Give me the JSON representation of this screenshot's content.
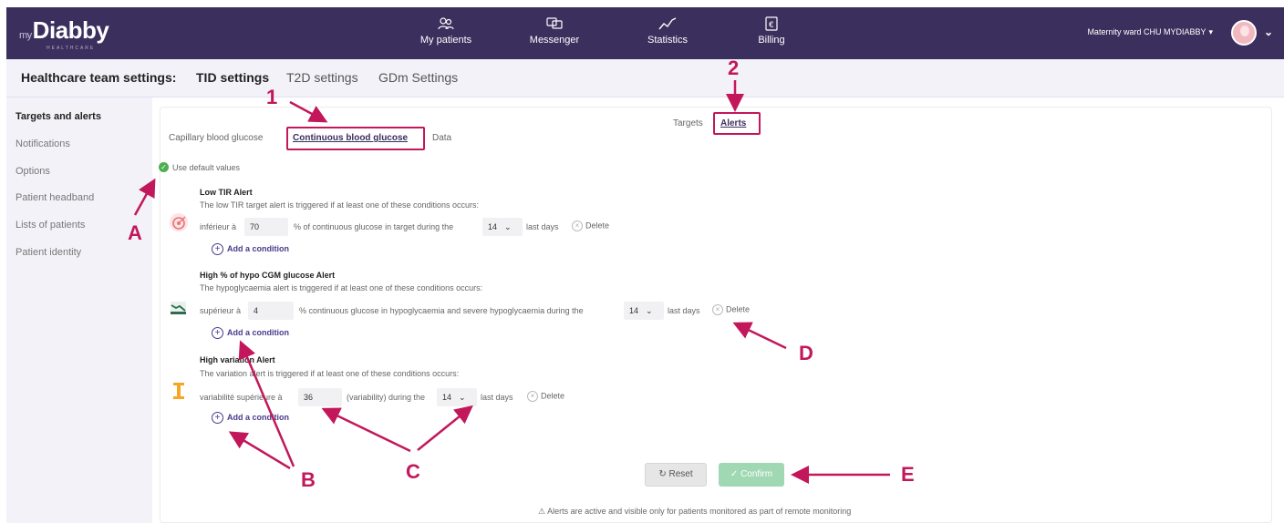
{
  "app": {
    "logo_prefix": "my",
    "logo": "Diabby",
    "logo_sub": "HEALTHCARE"
  },
  "nav": {
    "items": [
      {
        "label": "My patients",
        "icon": "patients-icon"
      },
      {
        "label": "Messenger",
        "icon": "chat-icon"
      },
      {
        "label": "Statistics",
        "icon": "chart-line-icon"
      },
      {
        "label": "Billing",
        "icon": "euro-doc-icon"
      }
    ],
    "ward": "Maternity ward CHU MYDIABBY"
  },
  "settings": {
    "title": "Healthcare team settings:",
    "tabs": [
      "TID settings",
      "T2D settings",
      "GDm Settings"
    ],
    "active_tab": 0
  },
  "sidebar": {
    "items": [
      "Targets and alerts",
      "Notifications",
      "Options",
      "Patient headband",
      "Lists of patients",
      "Patient identity"
    ],
    "active": 0
  },
  "main": {
    "subtabs": [
      "Capillary blood glucose",
      "Continuous blood glucose",
      "Data"
    ],
    "active_subtab": 1,
    "view_tabs": [
      "Targets",
      "Alerts"
    ],
    "active_view": 1,
    "default_values": "Use default values",
    "alerts": [
      {
        "title": "Low TIR Alert",
        "desc": "The low TIR target alert is triggered if at least one of these conditions occurs:",
        "prefix": "inférieur à",
        "value": "70",
        "middle": "% of continuous glucose in target during the",
        "days": "14",
        "suffix": "last days",
        "delete": "Delete",
        "add": "Add a condition"
      },
      {
        "title": "High % of hypo CGM glucose Alert",
        "desc": "The hypoglycaemia alert is triggered if at least one of these conditions occurs:",
        "prefix": "supérieur à",
        "value": "4",
        "middle": "% continuous glucose in hypoglycaemia and severe hypoglycaemia during the",
        "days": "14",
        "suffix": "last days",
        "delete": "Delete",
        "add": "Add a condition"
      },
      {
        "title": "High variation Alert",
        "desc": "The variation alert is triggered if at least one of these conditions occurs:",
        "prefix": "variabilité supérieure à",
        "value": "36",
        "middle": "(variability) during the",
        "days": "14",
        "suffix": "last days",
        "delete": "Delete",
        "add": "Add a condition"
      }
    ],
    "reset": "Reset",
    "confirm": "Confirm",
    "note": "Alerts are active and visible only for patients monitored as part of remote monitoring"
  },
  "annotations": [
    "1",
    "2",
    "A",
    "B",
    "C",
    "D",
    "E"
  ],
  "colors": {
    "nav_bg": "#3b2f5d",
    "accent": "#c2185b",
    "link": "#4a3a8c",
    "confirm": "#9fd8b3"
  }
}
